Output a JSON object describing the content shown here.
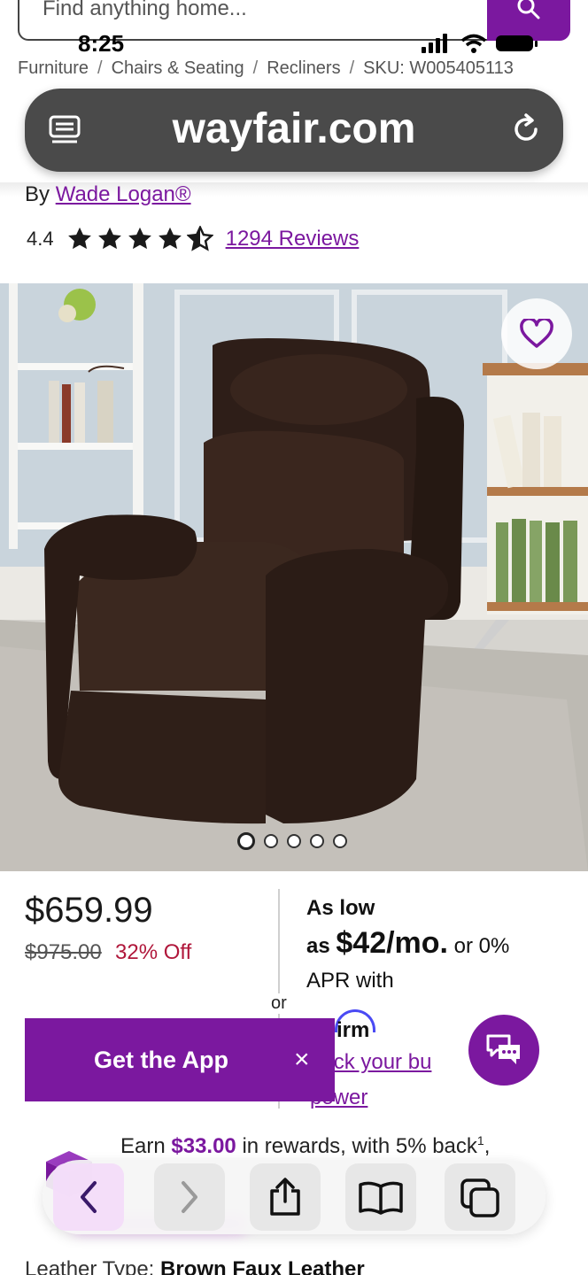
{
  "search": {
    "placeholder": "Find anything home..."
  },
  "status_bar": {
    "time": "8:25"
  },
  "breadcrumb": [
    "Furniture",
    "Chairs & Seating",
    "Recliners",
    "SKU: W005405113"
  ],
  "browser": {
    "url": "wayfair.com"
  },
  "product": {
    "by_prefix": "By",
    "brand": "Wade Logan®",
    "rating": "4.4",
    "rating_stars": 4.4,
    "reviews": "1294 Reviews",
    "image_count": 5,
    "active_image": 1
  },
  "pricing": {
    "price": "$659.99",
    "original_price": "$975.00",
    "discount": "32% Off",
    "or": "or",
    "as_low": "As low",
    "as_prefix": "as",
    "monthly": "$42/mo.",
    "apr_suffix": "or 0%",
    "apr_with": "APR with",
    "affirm": "irm",
    "check_link": "heck your bu power"
  },
  "banner": {
    "get_app": "Get the App",
    "close": "×"
  },
  "rewards": {
    "earn": "Earn",
    "amount": "$33.00",
    "rest": "in rewards, with 5% back",
    "sup": "1",
    "tail": ","
  },
  "specs": {
    "leather_label": "Leather Type:",
    "leather_value": "Brown Faux Leather"
  },
  "colors": {
    "brand_purple": "#7b189f",
    "sale_red": "#b0173b"
  }
}
